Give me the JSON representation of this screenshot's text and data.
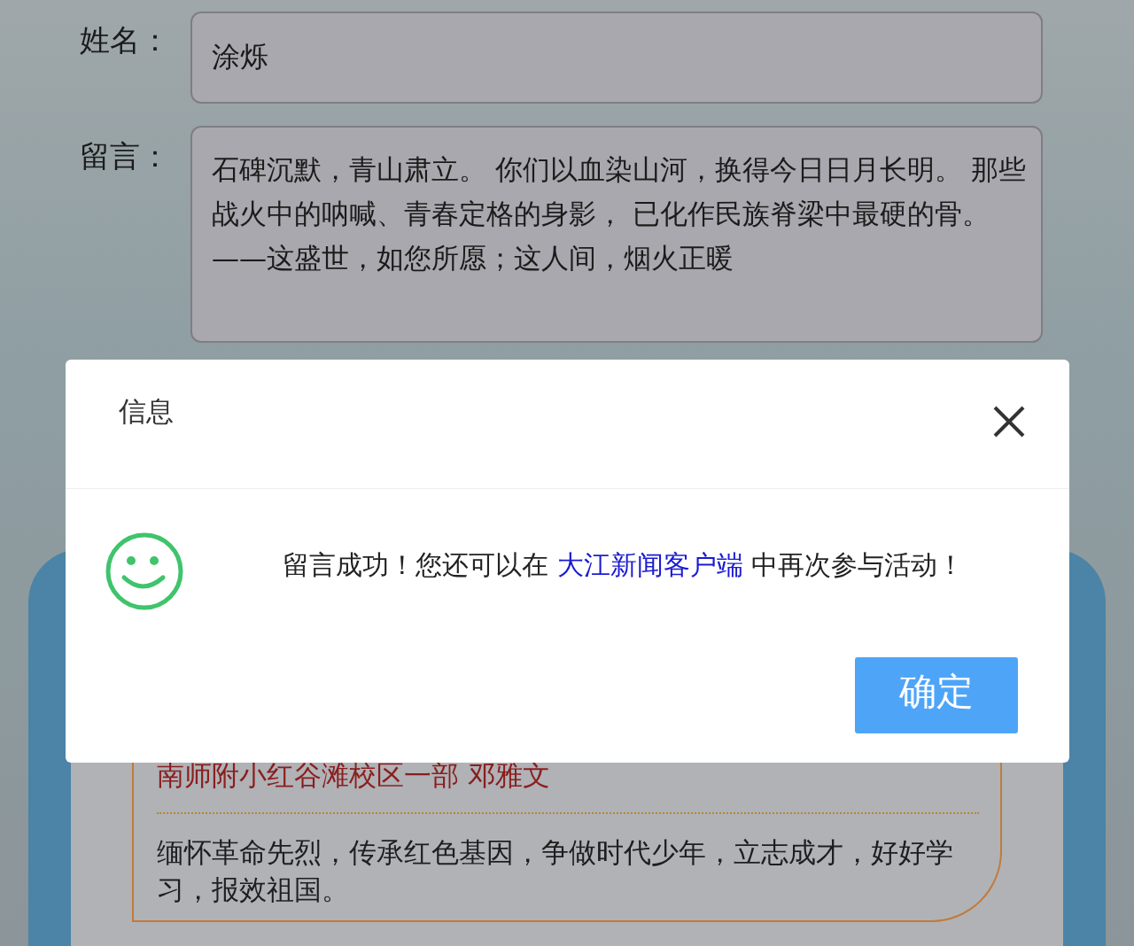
{
  "form": {
    "fields": [
      {
        "kind": "input",
        "label": "姓名：",
        "value": "涂烁"
      },
      {
        "kind": "textarea",
        "label": "留言：",
        "value": "石碑沉默，青山肃立。 你们以血染山河，换得今日日月长明。 那些战火中的呐喊、青春定格的身影， 已化作民族脊梁中最硬的骨。 ——这盛世，如您所愿；这人间，烟火正暖"
      }
    ]
  },
  "message_card": {
    "author": "南师附小红谷滩校区一部 邓雅文",
    "text": "缅怀革命先烈，传承红色基因，争做时代少年，立志成才，好好学习，报效祖国。"
  },
  "dialog": {
    "title": "信息",
    "message_before": "留言成功！您还可以在 ",
    "link": "大江新闻客户端",
    "message_after": " 中再次参与活动！",
    "button": "确定"
  }
}
